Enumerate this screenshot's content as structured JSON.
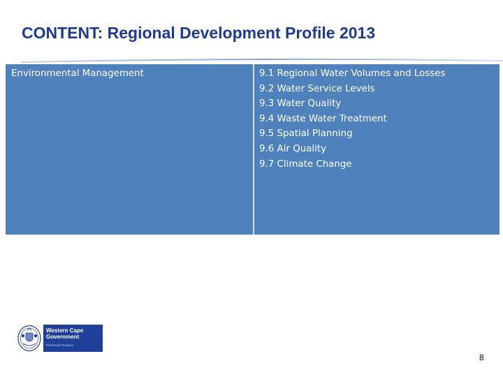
{
  "slide": {
    "title": "CONTENT: Regional Development Profile 2013",
    "page_number": "8"
  },
  "table": {
    "category": "Environmental Management",
    "topics": [
      "9.1 Regional Water Volumes and Losses",
      "9.2 Water Service Levels",
      "9.3 Water Quality",
      "9.4 Waste Water Treatment",
      "9.5 Spatial Planning",
      "9.6 Air Quality",
      "9.7 Climate Change"
    ]
  },
  "logo": {
    "line1": "Western Cape",
    "line2": "Government",
    "line3": "Provincial Treasury",
    "icon": "coat-of-arms-icon"
  },
  "colors": {
    "title": "#1f3a93",
    "cell_background": "#4f81bd",
    "logo_background": "#1f3f99"
  }
}
